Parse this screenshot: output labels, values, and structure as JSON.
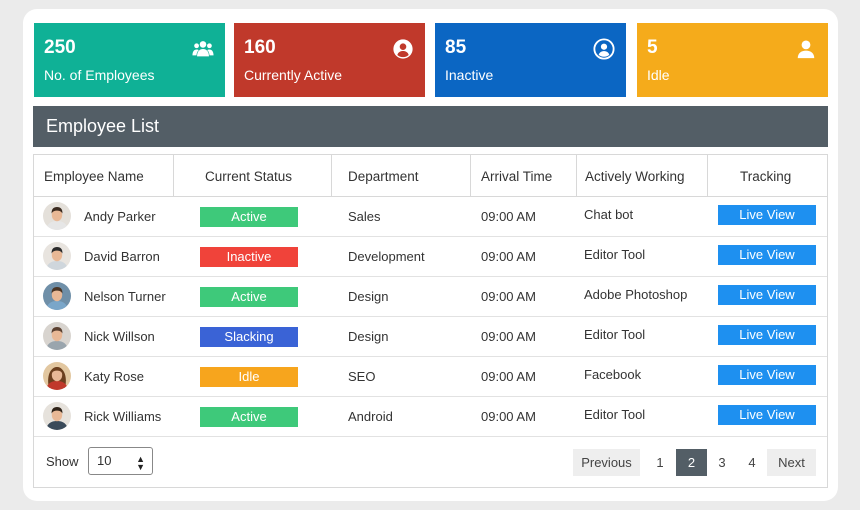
{
  "stats": [
    {
      "value": "250",
      "label": "No. of Employees",
      "color": "#0fb196",
      "icon": "users-icon"
    },
    {
      "value": "160",
      "label": "Currently Active",
      "color": "#c0392b",
      "icon": "user-circle-icon"
    },
    {
      "value": "85",
      "label": "Inactive",
      "color": "#0b66c3",
      "icon": "user-circle-icon"
    },
    {
      "value": "5",
      "label": "Idle",
      "color": "#f5ab1b",
      "icon": "user-icon"
    }
  ],
  "list_title": "Employee List",
  "columns": [
    "Employee Name",
    "Current Status",
    "Department",
    "Arrival Time",
    "Actively Working",
    "Tracking"
  ],
  "rows": [
    {
      "name": "Andy Parker",
      "status": "Active",
      "status_color": "#3ec97a",
      "department": "Sales",
      "arrival": "09:00 AM",
      "working": "Chat bot",
      "tracking": "Live View"
    },
    {
      "name": "David Barron",
      "status": "Inactive",
      "status_color": "#f0433a",
      "department": "Development",
      "arrival": "09:00 AM",
      "working": "Editor Tool",
      "tracking": "Live View"
    },
    {
      "name": "Nelson Turner",
      "status": "Active",
      "status_color": "#3ec97a",
      "department": "Design",
      "arrival": "09:00 AM",
      "working": "Adobe Photoshop",
      "tracking": "Live View"
    },
    {
      "name": "Nick Willson",
      "status": "Slacking",
      "status_color": "#3a63d6",
      "department": "Design",
      "arrival": "09:00 AM",
      "working": "Editor Tool",
      "tracking": "Live View"
    },
    {
      "name": "Katy Rose",
      "status": "Idle",
      "status_color": "#f7a51d",
      "department": "SEO",
      "arrival": "09:00 AM",
      "working": "Facebook",
      "tracking": "Live View"
    },
    {
      "name": "Rick Williams",
      "status": "Active",
      "status_color": "#3ec97a",
      "department": "Android",
      "arrival": "09:00 AM",
      "working": "Editor Tool",
      "tracking": "Live View"
    }
  ],
  "footer": {
    "show_label": "Show",
    "page_size": "10",
    "prev_label": "Previous",
    "pages": [
      "1",
      "2",
      "3",
      "4"
    ],
    "current_page": "2",
    "next_label": "Next"
  }
}
